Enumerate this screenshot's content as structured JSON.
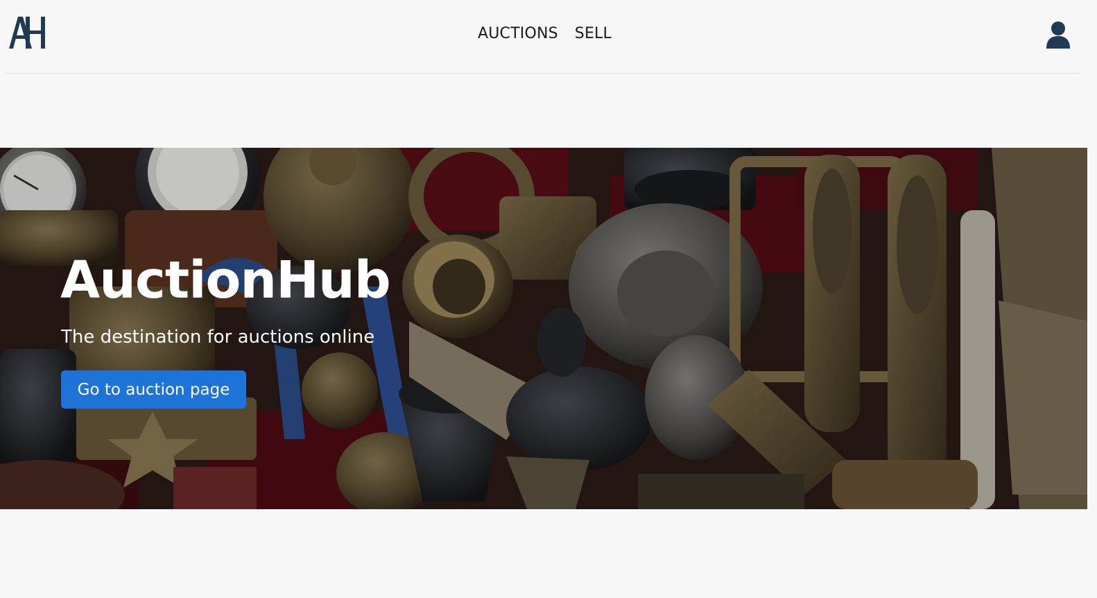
{
  "brand": {
    "logo_text": "AH",
    "logo_color": "#1f3a52"
  },
  "navbar": {
    "links": [
      {
        "label": "AUCTIONS"
      },
      {
        "label": "SELL"
      }
    ],
    "user_icon": "user-icon"
  },
  "hero": {
    "title": "AuctionHub",
    "subtitle": "The destination for auctions online",
    "cta_label": "Go to auction page",
    "cta_color": "#1e73d8",
    "background": "antique-objects-photo"
  }
}
